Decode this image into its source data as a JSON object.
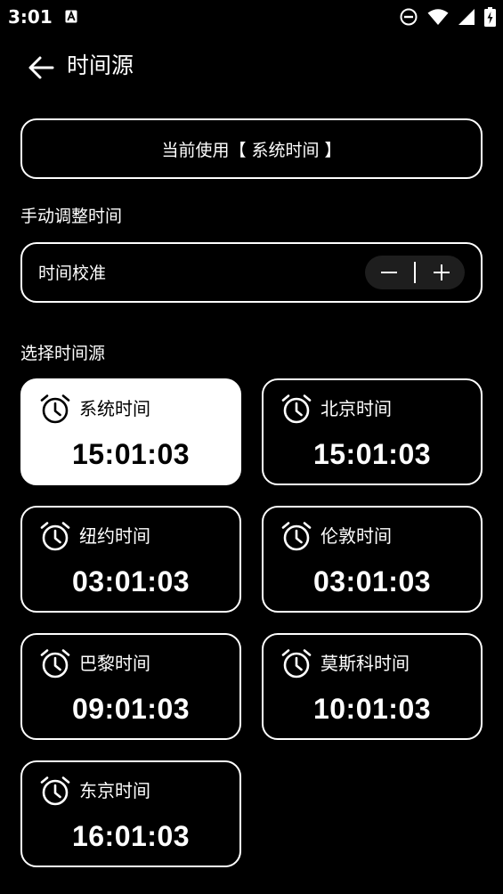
{
  "status_bar": {
    "time": "3:01",
    "icons": [
      "a-notification-icon",
      "dnd-icon",
      "wifi-icon",
      "signal-icon",
      "battery-charging-icon"
    ]
  },
  "header": {
    "back_icon": "arrow-left-icon",
    "title": "时间源"
  },
  "current_source": {
    "label": "当前使用【 系统时间 】"
  },
  "manual": {
    "section_label": "手动调整时间",
    "row_label": "时间校准",
    "minus": "−",
    "plus": "+"
  },
  "select": {
    "section_label": "选择时间源"
  },
  "sources": [
    {
      "name": "系统时间",
      "time": "15:01:03",
      "selected": true
    },
    {
      "name": "北京时间",
      "time": "15:01:03",
      "selected": false
    },
    {
      "name": "纽约时间",
      "time": "03:01:03",
      "selected": false
    },
    {
      "name": "伦敦时间",
      "time": "03:01:03",
      "selected": false
    },
    {
      "name": "巴黎时间",
      "time": "09:01:03",
      "selected": false
    },
    {
      "name": "莫斯科时间",
      "time": "10:01:03",
      "selected": false
    },
    {
      "name": "东京时间",
      "time": "16:01:03",
      "selected": false
    }
  ],
  "colors": {
    "background": "#000000",
    "foreground": "#ffffff",
    "stepper_bg": "#1e1e1e",
    "selected_card_bg": "#ffffff",
    "selected_card_text": "#000000"
  }
}
